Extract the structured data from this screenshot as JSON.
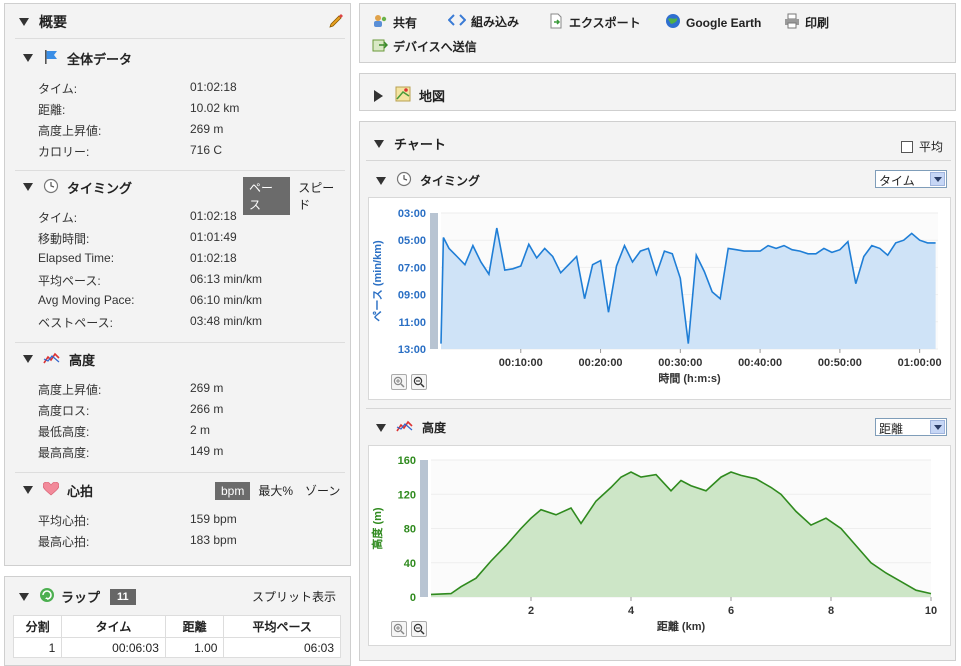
{
  "summary": {
    "title": "概要",
    "overall": {
      "title": "全体データ",
      "rows": [
        {
          "k": "タイム:",
          "v": "01:02:18"
        },
        {
          "k": "距離:",
          "v": "10.02 km"
        },
        {
          "k": "高度上昇値:",
          "v": "269 m"
        },
        {
          "k": "カロリー:",
          "v": "716 C"
        }
      ]
    },
    "timing": {
      "title": "タイミング",
      "toggle_on": "ペース",
      "toggle_off": "スピード",
      "rows": [
        {
          "k": "タイム:",
          "v": "01:02:18"
        },
        {
          "k": "移動時間:",
          "v": "01:01:49"
        },
        {
          "k": "Elapsed Time:",
          "v": "01:02:18"
        },
        {
          "k": "平均ペース:",
          "v": "06:13 min/km"
        },
        {
          "k": "Avg Moving Pace:",
          "v": "06:10 min/km"
        },
        {
          "k": "ベストペース:",
          "v": "03:48 min/km"
        }
      ]
    },
    "elevation": {
      "title": "高度",
      "rows": [
        {
          "k": "高度上昇値:",
          "v": "269 m"
        },
        {
          "k": "高度ロス:",
          "v": "266 m"
        },
        {
          "k": "最低高度:",
          "v": "2 m"
        },
        {
          "k": "最高高度:",
          "v": "149 m"
        }
      ]
    },
    "heart": {
      "title": "心拍",
      "toggle_on": "bpm",
      "toggle_mid": "最大%",
      "toggle_off": "ゾーン",
      "rows": [
        {
          "k": "平均心拍:",
          "v": "159 bpm"
        },
        {
          "k": "最高心拍:",
          "v": "183 bpm"
        }
      ]
    }
  },
  "laps": {
    "title": "ラップ",
    "count": "11",
    "split_label": "スプリット表示",
    "columns": [
      "分割",
      "タイム",
      "距離",
      "平均ペース"
    ],
    "rows": [
      [
        "1",
        "00:06:03",
        "1.00",
        "06:03"
      ]
    ]
  },
  "toolbar": {
    "share": "共有",
    "embed": "組み込み",
    "export": "エクスポート",
    "google_earth": "Google Earth",
    "print": "印刷",
    "send_device": "デバイスへ送信"
  },
  "map": {
    "title": "地図"
  },
  "charts": {
    "title": "チャート",
    "average_label": "平均",
    "timing": {
      "title": "タイミング",
      "select": "タイム"
    },
    "elevation": {
      "title": "高度",
      "select": "距離"
    }
  },
  "colors": {
    "pace_line": "#1f7ed6",
    "pace_fill": "#cfe3f7",
    "elev_line": "#2f8a1e",
    "elev_fill": "#cde6c7",
    "axis_pace": "#2a6fc4",
    "axis_elev": "#2f8a1e"
  },
  "chart_data": [
    {
      "type": "area",
      "ylabel": "ペース (min/km)",
      "xlabel": "時間 (h:m:s)",
      "y_ticks": [
        "03:00",
        "05:00",
        "07:00",
        "09:00",
        "11:00",
        "13:00"
      ],
      "x_ticks": [
        "00:10:00",
        "00:20:00",
        "00:30:00",
        "00:40:00",
        "00:50:00",
        "01:00:00"
      ],
      "ylim": [
        3,
        13
      ],
      "y_inverted": true,
      "xlim": [
        0,
        62.3
      ],
      "x": [
        0,
        0.3,
        1,
        2,
        3,
        4,
        5,
        6,
        7,
        8,
        9,
        10,
        11,
        12,
        13,
        14,
        15,
        16,
        17,
        18,
        19,
        20,
        21,
        22,
        23,
        24,
        25,
        26,
        27,
        28,
        29,
        30,
        31,
        32,
        33,
        34,
        35,
        36,
        37,
        38,
        39,
        40,
        41,
        42,
        43,
        44,
        45,
        46,
        47,
        48,
        49,
        50,
        51,
        52,
        53,
        54,
        55,
        56,
        57,
        58,
        59,
        60,
        61,
        62
      ],
      "values": [
        12.6,
        4.8,
        5.6,
        6.2,
        6.8,
        5.4,
        6.6,
        7.5,
        4.1,
        7.2,
        7.1,
        6.9,
        5.3,
        6.3,
        5.6,
        6.2,
        7.4,
        6.8,
        6.2,
        9.3,
        6.8,
        6.5,
        10.3,
        6.9,
        5.4,
        6.6,
        5.8,
        5.6,
        7.5,
        5.8,
        6.0,
        7.8,
        12.6,
        6.1,
        7.3,
        8.8,
        9.3,
        5.6,
        5.7,
        5.8,
        5.8,
        5.8,
        5.4,
        5.6,
        5.4,
        5.7,
        5.8,
        6.0,
        6.0,
        5.6,
        5.9,
        5.7,
        5.1,
        8.2,
        6.2,
        5.4,
        5.6,
        6.1,
        5.2,
        5.0,
        4.5,
        5.0,
        5.2,
        5.2
      ]
    },
    {
      "type": "area",
      "ylabel": "高度 (m)",
      "xlabel": "距離 (km)",
      "y_ticks": [
        "160",
        "120",
        "80",
        "40",
        "0"
      ],
      "x_ticks": [
        "2",
        "4",
        "6",
        "8",
        "10"
      ],
      "ylim": [
        0,
        160
      ],
      "xlim": [
        0,
        10
      ],
      "x": [
        0,
        0.4,
        0.6,
        0.9,
        1.2,
        1.5,
        1.8,
        2.0,
        2.2,
        2.5,
        2.8,
        3.0,
        3.3,
        3.6,
        3.8,
        4.0,
        4.2,
        4.5,
        4.8,
        5.0,
        5.2,
        5.5,
        5.8,
        6.0,
        6.2,
        6.5,
        6.8,
        7.0,
        7.3,
        7.6,
        7.9,
        8.2,
        8.5,
        8.8,
        9.1,
        9.4,
        9.7,
        10.0
      ],
      "values": [
        3,
        4,
        12,
        22,
        42,
        60,
        80,
        92,
        102,
        96,
        104,
        86,
        112,
        128,
        140,
        146,
        140,
        143,
        124,
        136,
        130,
        124,
        140,
        146,
        142,
        138,
        128,
        120,
        100,
        84,
        92,
        80,
        60,
        40,
        28,
        18,
        8,
        4
      ]
    }
  ]
}
